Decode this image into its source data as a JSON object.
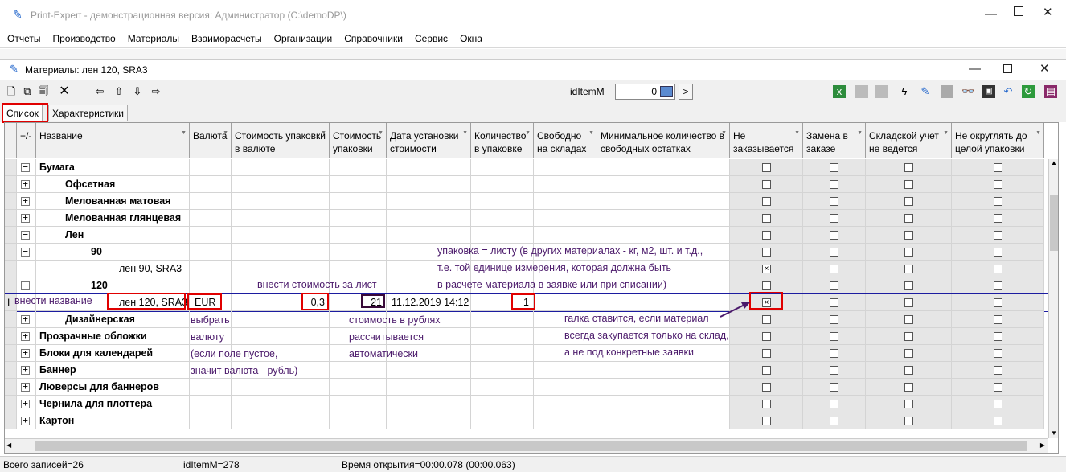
{
  "app": {
    "title": "Print-Expert - демонстрационная версия: Администратор (C:\\demoDP\\)",
    "menu": [
      "Отчеты",
      "Производство",
      "Материалы",
      "Взаиморасчеты",
      "Организации",
      "Справочники",
      "Сервис",
      "Окна"
    ]
  },
  "child": {
    "title": "Материалы: лен 120, SRA3"
  },
  "toolbar": {
    "id_label": "idItemM",
    "id_value": "0",
    "go_label": ">"
  },
  "tabs": [
    "Список",
    "Характеристики"
  ],
  "columns": [
    "+/-",
    "Название",
    "Валюта",
    "Стоимость упаковки в валюте",
    "Стоимость упаковки",
    "Дата установки стоимости",
    "Количество в упаковке",
    "Свободно на складах",
    "Минимальное количество в свободных остатках",
    "Не заказывается",
    "Замена в заказе",
    "Складской учет не ведется",
    "Не округлять до целой упаковки"
  ],
  "rows": [
    {
      "level": 0,
      "sign": "−",
      "name": "Бумага",
      "bold": true
    },
    {
      "level": 1,
      "sign": "+",
      "name": "Офсетная",
      "bold": true
    },
    {
      "level": 1,
      "sign": "+",
      "name": "Мелованная матовая",
      "bold": true
    },
    {
      "level": 1,
      "sign": "+",
      "name": "Мелованная глянцевая",
      "bold": true
    },
    {
      "level": 1,
      "sign": "−",
      "name": "Лен",
      "bold": true
    },
    {
      "level": 2,
      "sign": "−",
      "name": "90",
      "bold": true
    },
    {
      "level": 3,
      "sign": "",
      "name": "лен 90, SRA3",
      "bold": false,
      "checked": "×"
    },
    {
      "level": 2,
      "sign": "−",
      "name": "120",
      "bold": true
    },
    {
      "level": 3,
      "sign": "",
      "name": "лен 120, SRA3",
      "bold": false,
      "selected": true,
      "currency": "EUR",
      "price_cur": "0,3",
      "price": "21",
      "date": "11.12.2019 14:12",
      "qty": "1",
      "checked": "×"
    },
    {
      "level": 1,
      "sign": "+",
      "name": "Дизайнерская",
      "bold": true
    },
    {
      "level": 0,
      "sign": "+",
      "name": "Прозрачные обложки",
      "bold": true
    },
    {
      "level": 0,
      "sign": "+",
      "name": "Блоки для календарей",
      "bold": true
    },
    {
      "level": 0,
      "sign": "+",
      "name": "Баннер",
      "bold": true
    },
    {
      "level": 0,
      "sign": "+",
      "name": "Люверсы для баннеров",
      "bold": true
    },
    {
      "level": 0,
      "sign": "+",
      "name": "Чернила для плоттера",
      "bold": true
    },
    {
      "level": 0,
      "sign": "+",
      "name": "Картон",
      "bold": true
    }
  ],
  "annotations": {
    "packaging": [
      "упаковка = листу (в других материалах - кг, м2, шт. и т.д.,",
      "т.е. той единице измерения, которая должна быть",
      "в расчете материала в заявке или при списании)"
    ],
    "enter_price": "внести стоимость за лист",
    "enter_name": "внести название",
    "choose_currency": [
      "выбрать",
      "валюту",
      "(если поле пустое,",
      "значит валюта - рубль)"
    ],
    "rub_price": [
      "стоимость в рублях",
      "рассчитывается",
      "автоматически"
    ],
    "checkmark": [
      "галка ставится, если материал",
      "всегда закупается только на склад,",
      "а не под конкретные заявки"
    ]
  },
  "status": {
    "records": "Всего записей=26",
    "id": "idItemM=278",
    "time": "Время открытия=00:00.078 (00:00.063)"
  },
  "colors": {
    "annotation": "#4b1a6b",
    "highlight": "#e00000",
    "row_line": "#1c1ca0"
  }
}
